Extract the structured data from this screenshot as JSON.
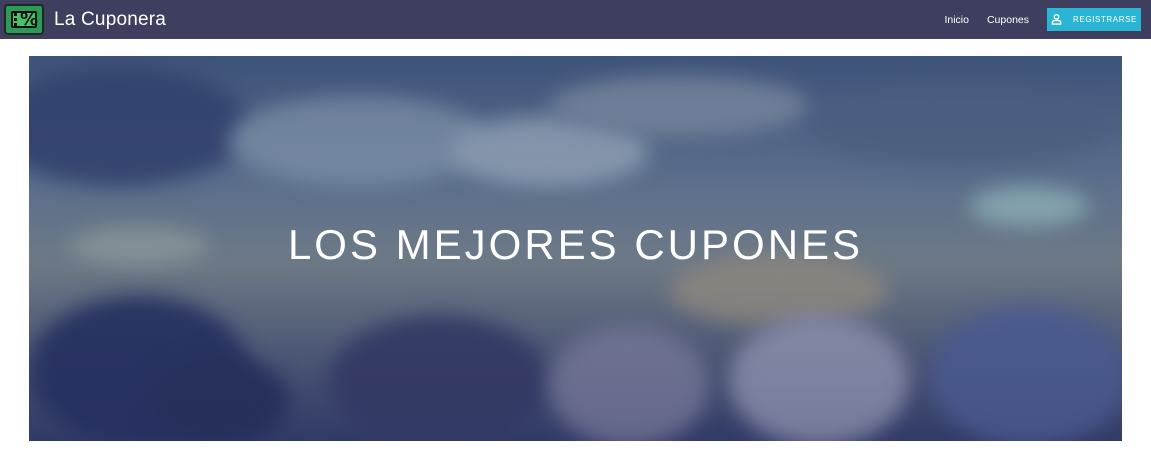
{
  "brand": {
    "name": "La Cuponera",
    "logo_icon": "coupon-percent-icon",
    "logo_symbol": "%"
  },
  "nav": {
    "links": [
      {
        "label": "Inicio"
      },
      {
        "label": "Cupones"
      }
    ],
    "register": {
      "label": "REGISTRARSE",
      "icon": "user-icon"
    }
  },
  "hero": {
    "title": "LOS MEJORES CUPONES"
  },
  "colors": {
    "navbar": "#3e3f5e",
    "accent": "#2bb5d4",
    "hero_overlay": "#28376e"
  }
}
